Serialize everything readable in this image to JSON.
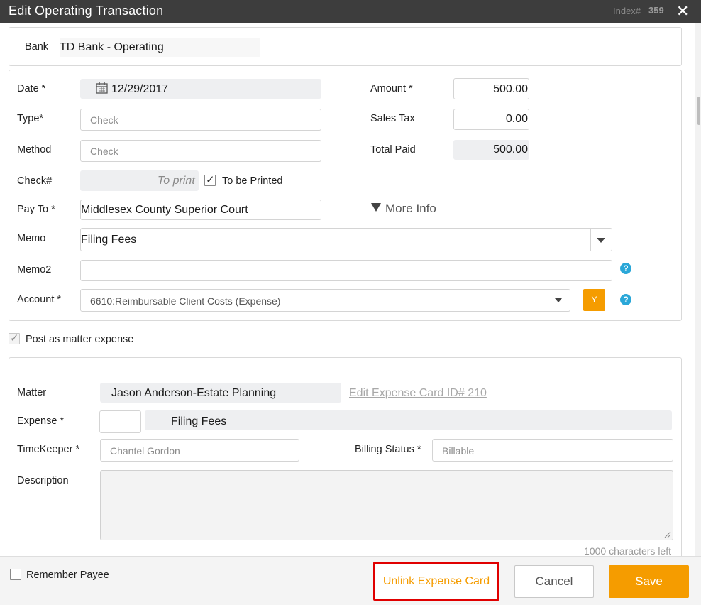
{
  "window": {
    "title": "Edit Operating Transaction",
    "index_label": "Index#",
    "index_value": "359"
  },
  "bank": {
    "label": "Bank",
    "value": "TD Bank - Operating"
  },
  "form": {
    "date_label": "Date *",
    "date_value": "12/29/2017",
    "type_label": "Type*",
    "type_placeholder": "Check",
    "method_label": "Method",
    "method_placeholder": "Check",
    "check_label": "Check#",
    "check_placeholder": "To print",
    "to_be_printed_label": "To be Printed",
    "to_be_printed_checked": true,
    "payto_label": "Pay To *",
    "payto_value": "Middlesex County Superior Court",
    "amount_label": "Amount *",
    "amount_value": "500.00",
    "salestax_label": "Sales Tax",
    "salestax_value": "0.00",
    "totalpaid_label": "Total Paid",
    "totalpaid_value": "500.00",
    "more_info_label": "More Info",
    "memo_label": "Memo",
    "memo_value": "Filing Fees",
    "memo2_label": "Memo2",
    "memo2_value": "",
    "account_label": "Account *",
    "account_value": "6610:Reimbursable Client Costs (Expense)",
    "account_button_label": "Y"
  },
  "post_matter": {
    "label": "Post as matter expense",
    "checked": true
  },
  "matter": {
    "matter_label": "Matter",
    "matter_value": "Jason Anderson-Estate Planning",
    "edit_link": "Edit Expense Card ID# 210",
    "expense_label": "Expense *",
    "expense_code": "",
    "expense_value": "Filing Fees",
    "timekeeper_label": "TimeKeeper *",
    "timekeeper_placeholder": "Chantel Gordon",
    "billing_label": "Billing Status *",
    "billing_placeholder": "Billable",
    "description_label": "Description",
    "description_value": "",
    "chars_left": "1000 characters left"
  },
  "footer": {
    "remember_payee_label": "Remember Payee",
    "remember_payee_checked": false,
    "unlink_label": "Unlink Expense Card",
    "cancel_label": "Cancel",
    "save_label": "Save"
  },
  "colors": {
    "title_bar": "#3d3d3d",
    "accent_orange": "#f59c00",
    "highlight_red": "#e00000",
    "help_blue": "#2aa7d8"
  },
  "icons": [
    "close-icon",
    "calendar-icon",
    "caret-down-icon",
    "help-icon",
    "checkmark-icon"
  ]
}
